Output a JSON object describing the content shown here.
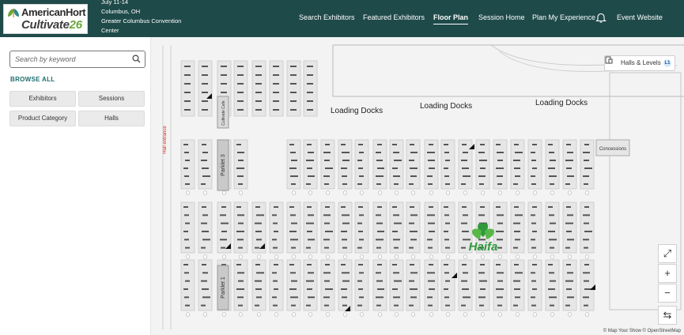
{
  "header": {
    "logo": {
      "top": "AmericanHort",
      "bottom": "Cultivate",
      "year": "26"
    },
    "event": {
      "dates": "July 11-14",
      "location": "Columbus, OH",
      "venue": "Greater Columbus Convention Center"
    },
    "nav": [
      {
        "label": "Search Exhibitors",
        "active": false
      },
      {
        "label": "Featured Exhibitors",
        "active": false
      },
      {
        "label": "Floor Plan",
        "active": true
      },
      {
        "label": "Session Home",
        "active": false
      },
      {
        "label": "Plan My Experience",
        "active": false
      },
      {
        "label": "Event Website",
        "active": false
      }
    ],
    "bell_icon": "bell-icon"
  },
  "sidebar": {
    "search_placeholder": "Search by keyword",
    "browse_all": "BROWSE ALL",
    "buttons": [
      "Exhibitors",
      "Sessions",
      "Product Category",
      "Halls"
    ]
  },
  "map": {
    "halls_button": "Halls & Levels",
    "level": "L1",
    "loading_docks": [
      "Loading Docks",
      "Loading Docks",
      "Loading Docks"
    ],
    "labels": {
      "parklet_3": "Parklet 3",
      "parklet_1": "Parklet 1",
      "concessions": "Concessions",
      "cultivate_cafe": "Cultivate Cafe",
      "entrance": "Hall entrance",
      "haifa": "Haifa"
    },
    "controls": {
      "fit": "⤢",
      "zoom_in": "+",
      "zoom_out": "−",
      "compass": "⇆"
    },
    "attribution": "© Map Your Show © OpenStreetMap"
  },
  "colors": {
    "header_bg": "#1f4a4a",
    "accent": "#1f6d6d",
    "haifa_green": "#2f9a3c"
  }
}
